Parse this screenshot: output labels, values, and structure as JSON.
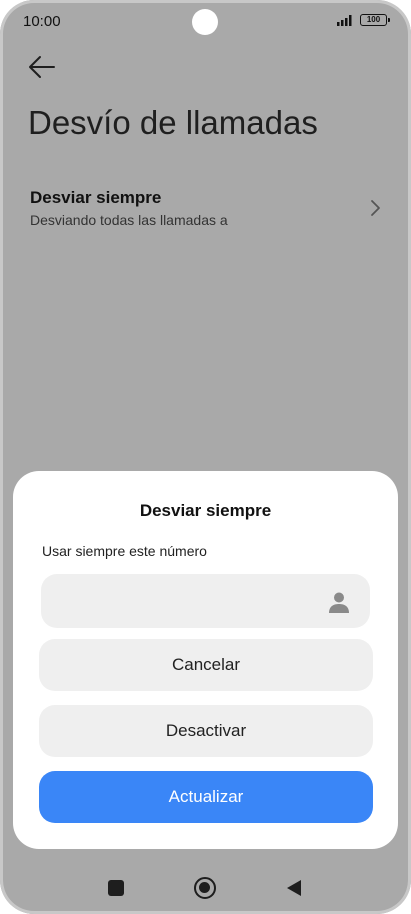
{
  "status_bar": {
    "time": "10:00",
    "battery": "100"
  },
  "header": {
    "title": "Desvío de llamadas",
    "back_icon": "arrow-left-icon"
  },
  "setting": {
    "title": "Desviar siempre",
    "subtitle": "Desviando todas las llamadas a",
    "chevron_icon": "chevron-right-icon"
  },
  "dialog": {
    "title": "Desviar siempre",
    "label": "Usar siempre este número",
    "input_value": "",
    "input_placeholder": "",
    "contact_icon": "contact-person-icon",
    "cancel_label": "Cancelar",
    "deactivate_label": "Desactivar",
    "update_label": "Actualizar"
  },
  "colors": {
    "accent": "#3a86f7",
    "scrim_background": "#a9a9a9",
    "button_background": "#efefef"
  },
  "nav_bar": {
    "recents_icon": "square-recents-icon",
    "home_icon": "circle-home-icon",
    "back_icon": "triangle-back-icon"
  }
}
